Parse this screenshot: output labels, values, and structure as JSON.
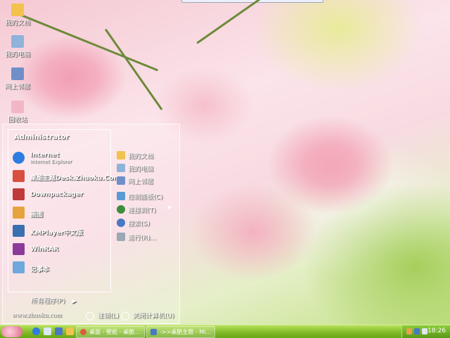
{
  "desktop": {
    "icons": [
      {
        "label": "我的文档",
        "icon": "folder-icon",
        "color": "#f2c14e"
      },
      {
        "label": "我的电脑",
        "icon": "computer-icon",
        "color": "#8fb3d9"
      },
      {
        "label": "网上邻居",
        "icon": "network-icon",
        "color": "#6f8fc8"
      },
      {
        "label": "回收站",
        "icon": "recycle-bin-icon",
        "color": "#f3b6c6"
      }
    ]
  },
  "start_menu": {
    "user": "Administrator",
    "items": [
      {
        "title": "Internet",
        "subtitle": "Internet Explorer",
        "icon": "ie-icon",
        "color": "#2b7de0"
      },
      {
        "title": "桌酷主题Desk.Zhuoku.Com",
        "subtitle": "",
        "icon": "zhuoku-icon",
        "color": "#d94f3f"
      },
      {
        "title": "Downpackager",
        "subtitle": "",
        "icon": "package-icon",
        "color": "#c0393b"
      },
      {
        "title": "画图",
        "subtitle": "",
        "icon": "paint-icon",
        "color": "#e6a23c"
      },
      {
        "title": "KMPlayer中文版",
        "subtitle": "",
        "icon": "kmplayer-icon",
        "color": "#3a6fb0"
      },
      {
        "title": "WinRAR",
        "subtitle": "",
        "icon": "winrar-icon",
        "color": "#8c3a9a"
      },
      {
        "title": "记事本",
        "subtitle": "",
        "icon": "notepad-icon",
        "color": "#6fa8dc"
      }
    ],
    "all_programs": "所有程序(P)",
    "right_items": [
      {
        "label": "我的文档",
        "icon": "folder-icon",
        "color": "#f2c14e",
        "submenu": false
      },
      {
        "label": "我的电脑",
        "icon": "computer-icon",
        "color": "#8fb3d9",
        "submenu": false
      },
      {
        "label": "网上邻居",
        "icon": "network-icon",
        "color": "#6f8fc8",
        "submenu": false
      },
      {
        "label": "控制面板(C)",
        "icon": "control-panel-icon",
        "color": "#5a9bd5",
        "submenu": false
      },
      {
        "label": "连接到(T)",
        "icon": "connect-icon",
        "color": "#3c8d3c",
        "submenu": true
      },
      {
        "label": "搜索(S)",
        "icon": "search-icon",
        "color": "#4a78c2",
        "submenu": false
      },
      {
        "label": "运行(R)...",
        "icon": "run-icon",
        "color": "#9aa7b5",
        "submenu": false
      }
    ],
    "url": "www.zhuoku.com",
    "logoff": "注销(L)",
    "shutdown": "关闭计算机(U)"
  },
  "taskbar": {
    "tasks": [
      {
        "label": "桌面 - 壁纸 - 桌酷...",
        "icon": "browser-icon",
        "color": "#e05a3a"
      },
      {
        "label": "->>桌酷主题 - Mi...",
        "icon": "window-icon",
        "color": "#4a78c2"
      }
    ],
    "clock": "18:26"
  }
}
